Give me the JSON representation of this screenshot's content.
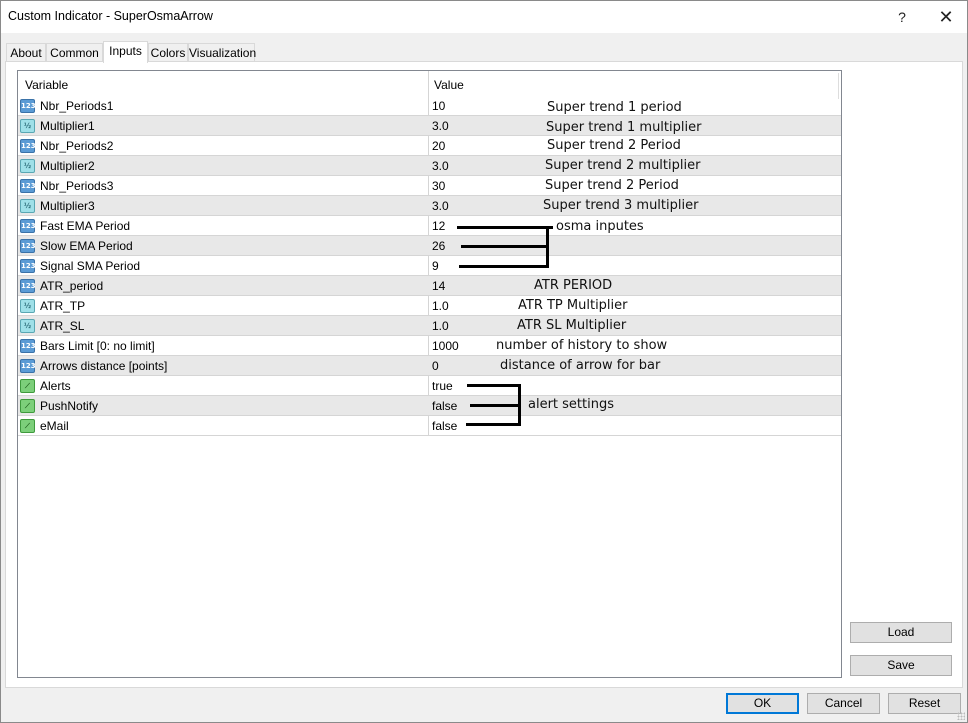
{
  "window": {
    "title": "Custom Indicator - SuperOsmaArrow",
    "help_label": "?",
    "close_label": "✕"
  },
  "tabs": [
    {
      "label": "About",
      "active": false
    },
    {
      "label": "Common",
      "active": false
    },
    {
      "label": "Inputs",
      "active": true
    },
    {
      "label": "Colors",
      "active": false
    },
    {
      "label": "Visualization",
      "active": false
    }
  ],
  "grid": {
    "columns": {
      "variable": "Variable",
      "value": "Value"
    },
    "rows": [
      {
        "type": "int",
        "icon": "integer-type-icon",
        "icon_text": "123",
        "variable": "Nbr_Periods1",
        "value": "10"
      },
      {
        "type": "dbl",
        "icon": "double-type-icon",
        "icon_text": "½",
        "variable": "Multiplier1",
        "value": "3.0"
      },
      {
        "type": "int",
        "icon": "integer-type-icon",
        "icon_text": "123",
        "variable": "Nbr_Periods2",
        "value": "20"
      },
      {
        "type": "dbl",
        "icon": "double-type-icon",
        "icon_text": "½",
        "variable": "Multiplier2",
        "value": "3.0"
      },
      {
        "type": "int",
        "icon": "integer-type-icon",
        "icon_text": "123",
        "variable": "Nbr_Periods3",
        "value": "30"
      },
      {
        "type": "dbl",
        "icon": "double-type-icon",
        "icon_text": "½",
        "variable": "Multiplier3",
        "value": "3.0"
      },
      {
        "type": "int",
        "icon": "integer-type-icon",
        "icon_text": "123",
        "variable": "Fast EMA Period",
        "value": "12"
      },
      {
        "type": "int",
        "icon": "integer-type-icon",
        "icon_text": "123",
        "variable": "Slow EMA Period",
        "value": "26"
      },
      {
        "type": "int",
        "icon": "integer-type-icon",
        "icon_text": "123",
        "variable": "Signal SMA Period",
        "value": "9"
      },
      {
        "type": "int",
        "icon": "integer-type-icon",
        "icon_text": "123",
        "variable": "ATR_period",
        "value": "14"
      },
      {
        "type": "dbl",
        "icon": "double-type-icon",
        "icon_text": "½",
        "variable": "ATR_TP",
        "value": "1.0"
      },
      {
        "type": "dbl",
        "icon": "double-type-icon",
        "icon_text": "½",
        "variable": "ATR_SL",
        "value": "1.0"
      },
      {
        "type": "int",
        "icon": "integer-type-icon",
        "icon_text": "123",
        "variable": "Bars Limit [0: no limit]",
        "value": "1000"
      },
      {
        "type": "int",
        "icon": "integer-type-icon",
        "icon_text": "123",
        "variable": "Arrows distance [points]",
        "value": "0"
      },
      {
        "type": "bool",
        "icon": "boolean-type-icon",
        "icon_text": "⟋",
        "variable": "Alerts",
        "value": "true"
      },
      {
        "type": "bool",
        "icon": "boolean-type-icon",
        "icon_text": "⟋",
        "variable": "PushNotify",
        "value": "false"
      },
      {
        "type": "bool",
        "icon": "boolean-type-icon",
        "icon_text": "⟋",
        "variable": "eMail",
        "value": "false"
      }
    ]
  },
  "annotations": {
    "st1_period": "Super trend 1 period",
    "st1_mult": "Super trend 1 multiplier",
    "st2_period": "Super trend 2 Period",
    "st2_mult": "Super trend 2 multiplier",
    "st3_period": "Super trend 2 Period",
    "st3_mult": "Super trend 3 multiplier",
    "osma": "osma inputes",
    "atr_period": "ATR PERIOD",
    "atr_tp": "ATR TP Multiplier",
    "atr_sl": "ATR SL Multiplier",
    "bars_limit": "number of history to show",
    "arrows_distance": "distance of arrow for bar",
    "alerts": "alert settings"
  },
  "buttons": {
    "load": "Load",
    "save": "Save",
    "ok": "OK",
    "cancel": "Cancel",
    "reset": "Reset"
  }
}
